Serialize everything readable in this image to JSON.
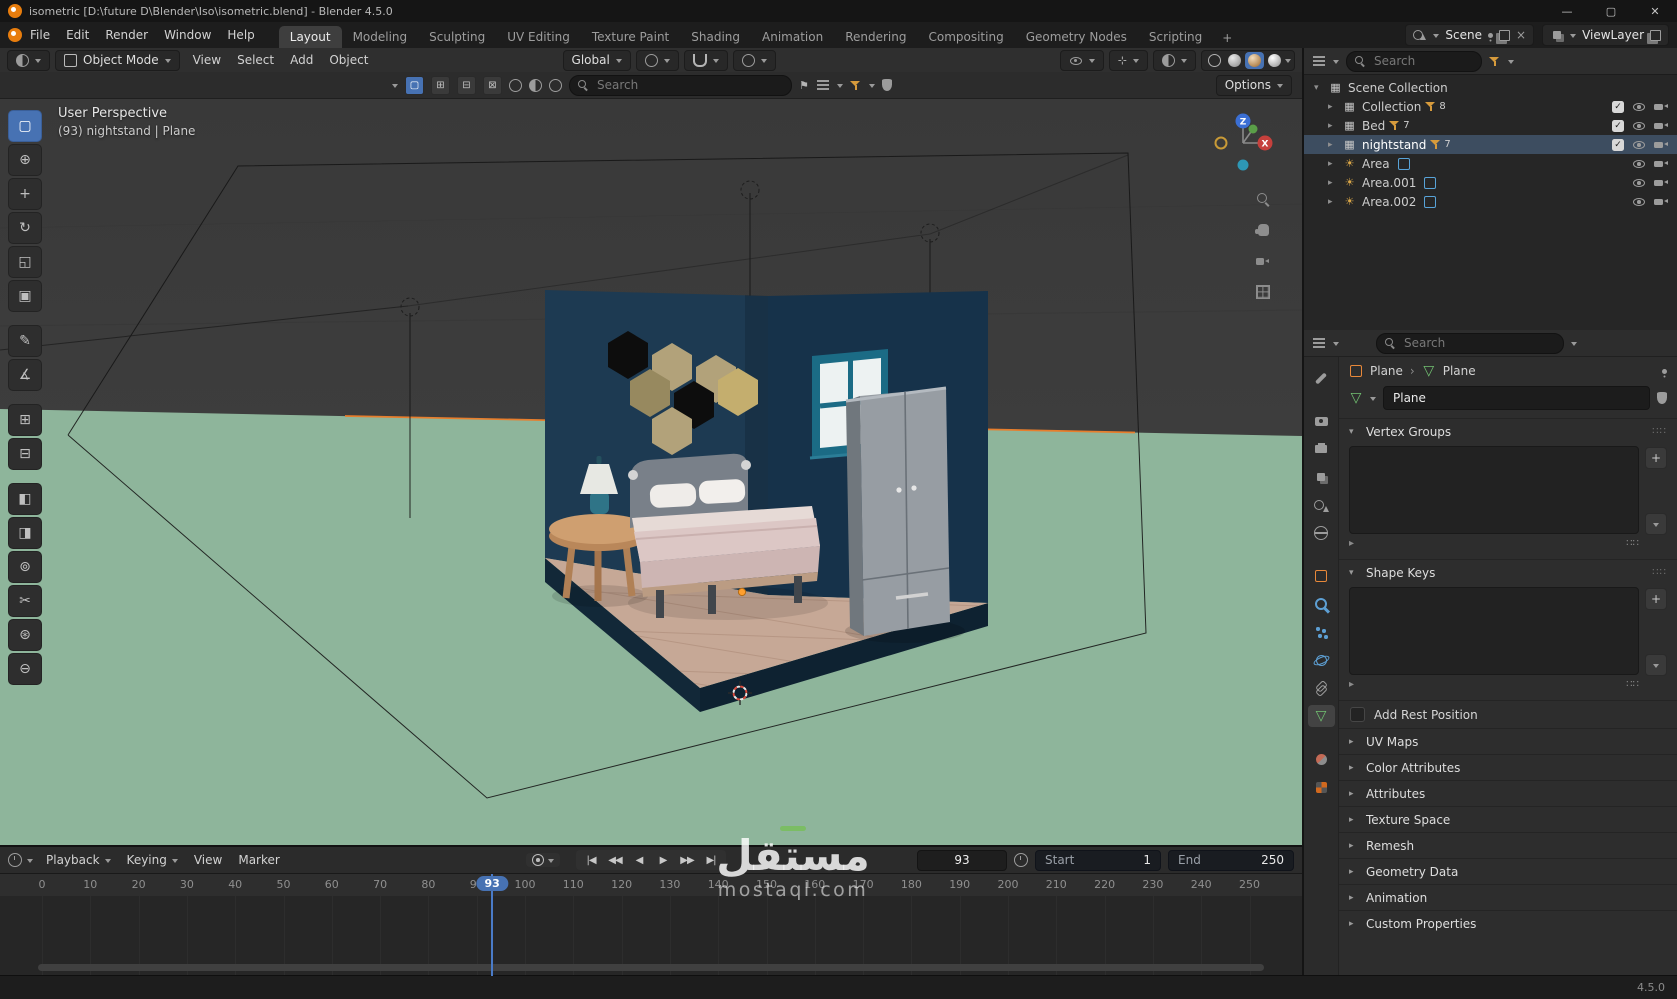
{
  "window": {
    "title": "isometric [D:\\future D\\Blender\\Iso\\isometric.blend] - Blender 4.5.0",
    "controls": {
      "minimize": "—",
      "maximize": "▢",
      "close": "✕"
    }
  },
  "topbar": {
    "menus": [
      "File",
      "Edit",
      "Render",
      "Window",
      "Help"
    ],
    "workspaces": {
      "active": "Layout",
      "tabs": [
        "Layout",
        "Modeling",
        "Sculpting",
        "UV Editing",
        "Texture Paint",
        "Shading",
        "Animation",
        "Rendering",
        "Compositing",
        "Geometry Nodes",
        "Scripting"
      ],
      "add_label": "+"
    },
    "scene_value": "Scene",
    "view_layer_value": "ViewLayer"
  },
  "viewport_header": {
    "mode_selector": "Object Mode",
    "menus": [
      "View",
      "Select",
      "Add",
      "Object"
    ],
    "orientation": "Global",
    "options_label": "Options"
  },
  "tool_settings": {
    "search_placeholder": "Search"
  },
  "toolbar": {
    "tools": [
      {
        "name": "tool-select-box",
        "glyph": "▢",
        "active": true,
        "gap": false
      },
      {
        "name": "tool-cursor",
        "glyph": "⊕",
        "active": false,
        "gap": false
      },
      {
        "name": "tool-move",
        "glyph": "+",
        "active": false,
        "gap": false
      },
      {
        "name": "tool-rotate",
        "glyph": "↻",
        "active": false,
        "gap": false
      },
      {
        "name": "tool-scale",
        "glyph": "◱",
        "active": false,
        "gap": false
      },
      {
        "name": "tool-transform",
        "glyph": "▣",
        "active": false,
        "gap": false
      },
      {
        "name": "tool-annotate",
        "glyph": "✎",
        "active": false,
        "gap": true
      },
      {
        "name": "tool-measure",
        "glyph": "∡",
        "active": false,
        "gap": false
      },
      {
        "name": "tool-add-cube",
        "glyph": "⊞",
        "active": false,
        "gap": true
      },
      {
        "name": "tool-extrude",
        "glyph": "⊟",
        "active": false,
        "gap": false
      },
      {
        "name": "tool-inset",
        "glyph": "◧",
        "active": false,
        "gap": true
      },
      {
        "name": "tool-bevel",
        "glyph": "◨",
        "active": false,
        "gap": false
      },
      {
        "name": "tool-loop-cut",
        "glyph": "⊚",
        "active": false,
        "gap": false
      },
      {
        "name": "tool-knife",
        "glyph": "✂",
        "active": false,
        "gap": false
      },
      {
        "name": "tool-poly-build",
        "glyph": "⊛",
        "active": false,
        "gap": false
      },
      {
        "name": "tool-spin",
        "glyph": "⊖",
        "active": false,
        "gap": false
      }
    ]
  },
  "viewport": {
    "overlay_line1": "User Perspective",
    "overlay_line2": "(93) nightstand | Plane",
    "gizmo": {
      "x": "X",
      "z": "Z"
    },
    "watermark_arabic": "مستقل",
    "watermark_domain": "mostaql.com"
  },
  "outliner": {
    "search_placeholder": "Search",
    "root_label": "Scene Collection",
    "items": [
      {
        "label": "Collection",
        "type": "collection",
        "badge": "8",
        "selected": false,
        "checkbox": true
      },
      {
        "label": "Bed",
        "type": "collection",
        "badge": "7",
        "selected": false,
        "checkbox": true
      },
      {
        "label": "nightstand",
        "type": "collection",
        "badge": "7",
        "selected": true,
        "checkbox": true
      },
      {
        "label": "Area",
        "type": "light",
        "badge": "",
        "selected": false,
        "checkbox": false
      },
      {
        "label": "Area.001",
        "type": "light",
        "badge": "",
        "selected": false,
        "checkbox": false
      },
      {
        "label": "Area.002",
        "type": "light",
        "badge": "",
        "selected": false,
        "checkbox": false
      }
    ]
  },
  "properties": {
    "search_placeholder": "Search",
    "tab_groups": [
      [
        "tool"
      ],
      [
        "render",
        "output",
        "view-layer",
        "scene",
        "world"
      ],
      [
        "object",
        "modifiers",
        "particles",
        "physics",
        "constraints",
        "object-data"
      ],
      [
        "material",
        "texture"
      ]
    ],
    "active_tab": "object-data",
    "breadcrumb": {
      "object": "Plane",
      "data": "Plane",
      "separator": "›"
    },
    "name_value": "Plane",
    "sections_open": [
      {
        "label": "Vertex Groups"
      },
      {
        "label": "Shape Keys"
      }
    ],
    "rest_position_label": "Add Rest Position",
    "sections_closed": [
      "UV Maps",
      "Color Attributes",
      "Attributes",
      "Texture Space",
      "Remesh",
      "Geometry Data",
      "Animation",
      "Custom Properties"
    ]
  },
  "timeline": {
    "menus": [
      "Playback",
      "Keying",
      "View",
      "Marker"
    ],
    "transport": [
      "|◀",
      "◀◀",
      "◀",
      "▶",
      "▶▶",
      "▶|"
    ],
    "current_frame": "93",
    "start_label": "Start",
    "start_value": "1",
    "end_label": "End",
    "end_value": "250",
    "ticks": [
      "0",
      "10",
      "20",
      "30",
      "40",
      "50",
      "60",
      "70",
      "80",
      "90",
      "100",
      "110",
      "120",
      "130",
      "140",
      "150",
      "160",
      "170",
      "180",
      "190",
      "200",
      "210",
      "220",
      "230",
      "240",
      "250"
    ]
  },
  "status_bar": {
    "version": "4.5.0"
  },
  "colors": {
    "accent_blue": "#4772b3",
    "selection_outline_orange": "#e77e2d",
    "object_orange": "#e8883a",
    "ground_green": "#8eb59b",
    "wall_navy": "#1d3a52",
    "mesh_data_green": "#71c171"
  }
}
